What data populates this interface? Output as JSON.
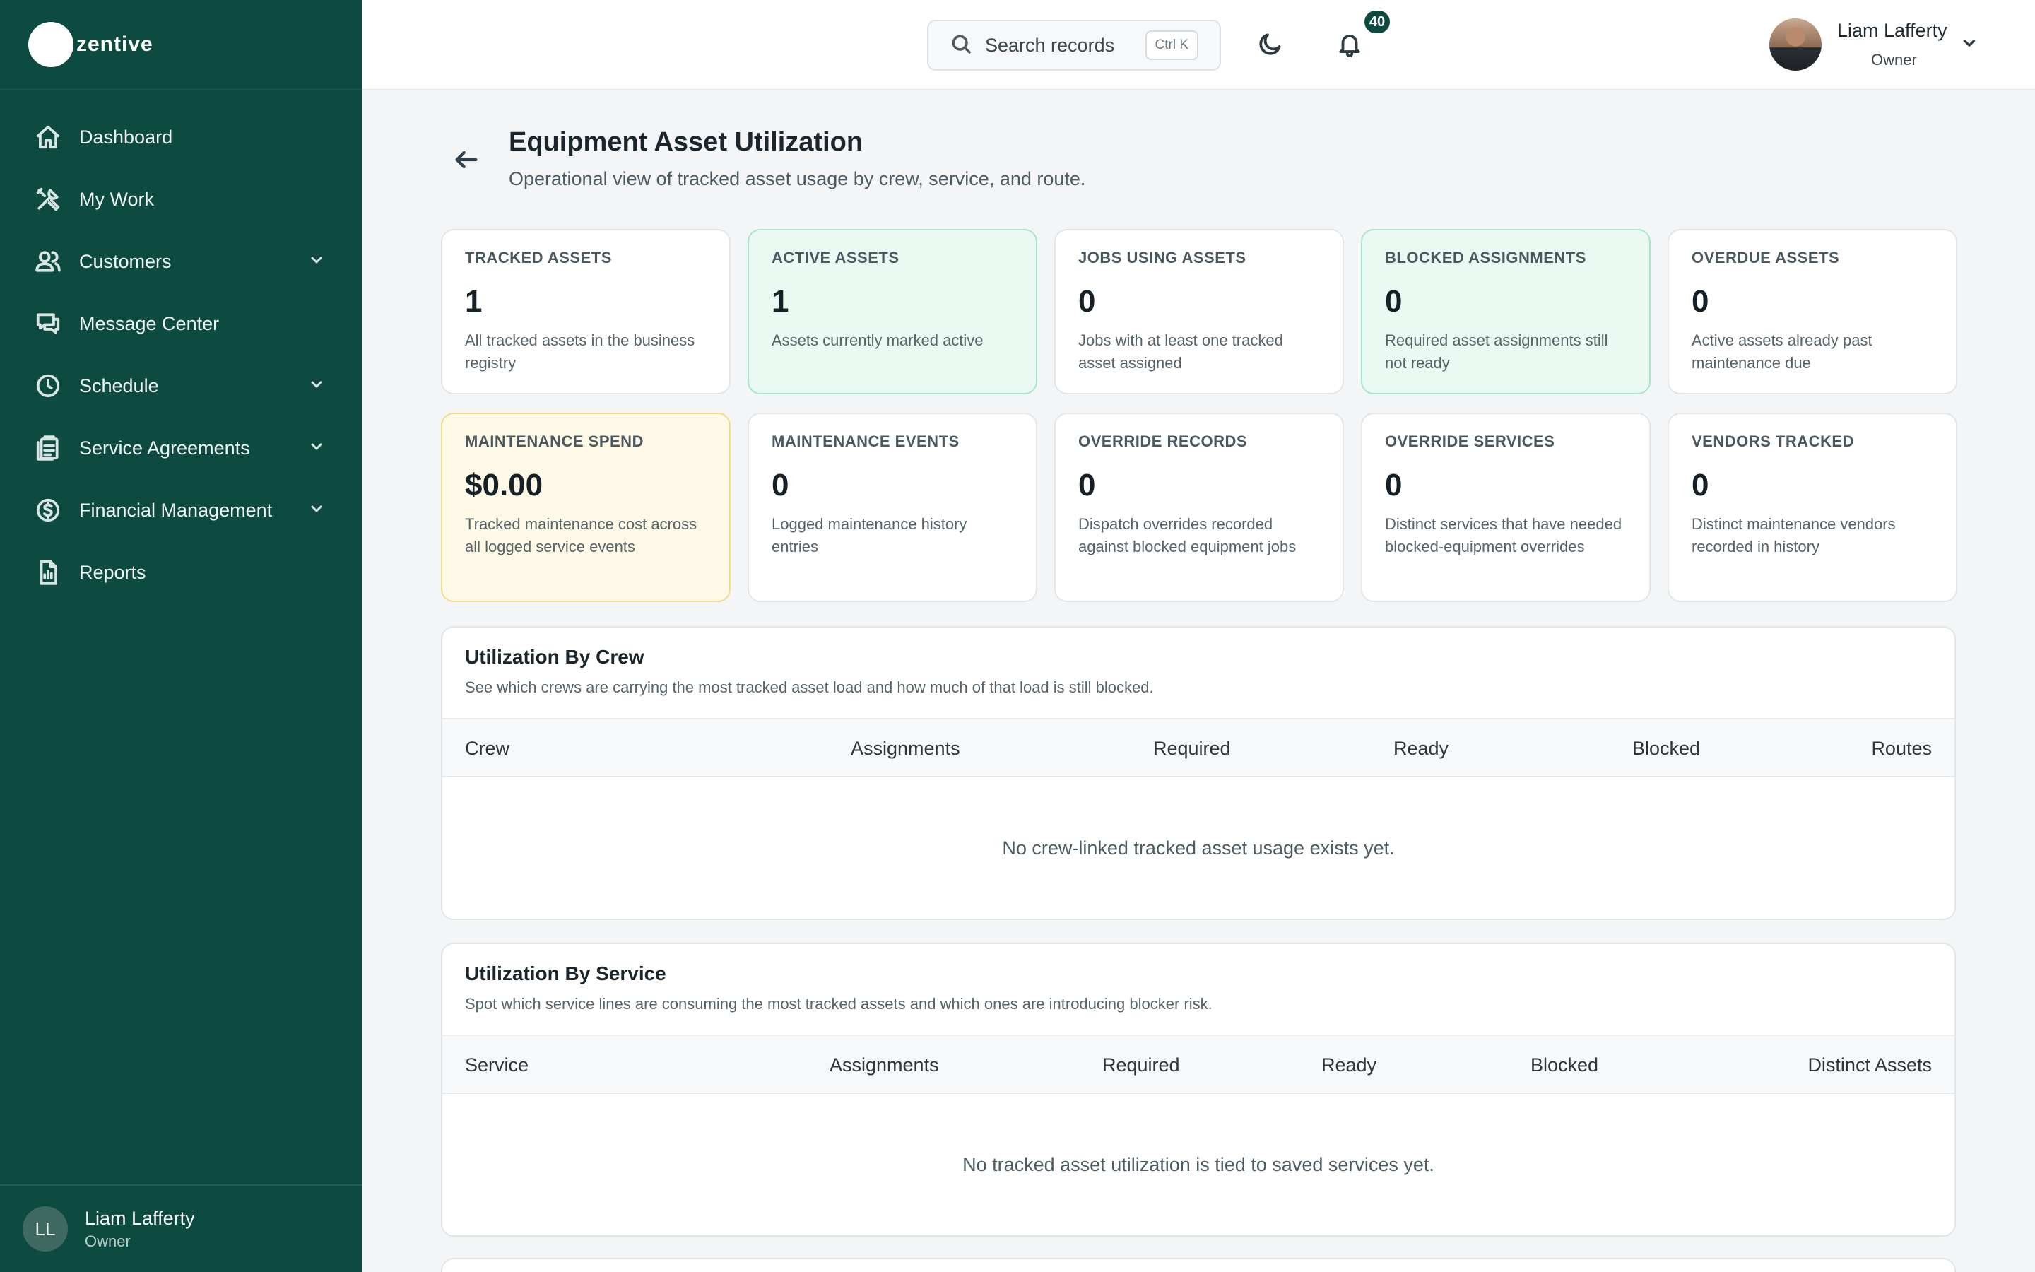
{
  "brand": {
    "name": "zentive"
  },
  "sidebar": {
    "items": [
      {
        "label": "Dashboard",
        "icon": "home-icon",
        "expandable": false
      },
      {
        "label": "My Work",
        "icon": "tools-icon",
        "expandable": false
      },
      {
        "label": "Customers",
        "icon": "users-icon",
        "expandable": true
      },
      {
        "label": "Message Center",
        "icon": "chat-icon",
        "expandable": false
      },
      {
        "label": "Schedule",
        "icon": "clock-icon",
        "expandable": true
      },
      {
        "label": "Service Agreements",
        "icon": "clipboard-icon",
        "expandable": true
      },
      {
        "label": "Financial Management",
        "icon": "dollar-circle-icon",
        "expandable": true
      },
      {
        "label": "Reports",
        "icon": "document-icon",
        "expandable": false
      }
    ],
    "user": {
      "initials": "LL",
      "name": "Liam Lafferty",
      "role": "Owner"
    }
  },
  "topbar": {
    "search_label": "Search records",
    "search_shortcut": "Ctrl K",
    "notification_count": "40",
    "user_name": "Liam Lafferty",
    "user_role": "Owner"
  },
  "page": {
    "title": "Equipment Asset Utilization",
    "subtitle": "Operational view of tracked asset usage by crew, service, and route."
  },
  "stats": [
    {
      "label": "TRACKED ASSETS",
      "value": "1",
      "desc": "All tracked assets in the business registry",
      "tone": "default"
    },
    {
      "label": "ACTIVE ASSETS",
      "value": "1",
      "desc": "Assets currently marked active",
      "tone": "green"
    },
    {
      "label": "JOBS USING ASSETS",
      "value": "0",
      "desc": "Jobs with at least one tracked asset assigned",
      "tone": "default"
    },
    {
      "label": "BLOCKED ASSIGNMENTS",
      "value": "0",
      "desc": "Required asset assignments still not ready",
      "tone": "green"
    },
    {
      "label": "OVERDUE ASSETS",
      "value": "0",
      "desc": "Active assets already past maintenance due",
      "tone": "default"
    },
    {
      "label": "MAINTENANCE SPEND",
      "value": "$0.00",
      "desc": "Tracked maintenance cost across all logged service events",
      "tone": "yellow"
    },
    {
      "label": "MAINTENANCE EVENTS",
      "value": "0",
      "desc": "Logged maintenance history entries",
      "tone": "default"
    },
    {
      "label": "OVERRIDE RECORDS",
      "value": "0",
      "desc": "Dispatch overrides recorded against blocked equipment jobs",
      "tone": "default"
    },
    {
      "label": "OVERRIDE SERVICES",
      "value": "0",
      "desc": "Distinct services that have needed blocked-equipment overrides",
      "tone": "default"
    },
    {
      "label": "VENDORS TRACKED",
      "value": "0",
      "desc": "Distinct maintenance vendors recorded in history",
      "tone": "default"
    }
  ],
  "sections": {
    "crew": {
      "title": "Utilization By Crew",
      "subtitle": "See which crews are carrying the most tracked asset load and how much of that load is still blocked.",
      "columns": [
        "Crew",
        "Assignments",
        "Required",
        "Ready",
        "Blocked",
        "Routes"
      ],
      "empty": "No crew-linked tracked asset usage exists yet."
    },
    "service": {
      "title": "Utilization By Service",
      "subtitle": "Spot which service lines are consuming the most tracked assets and which ones are introducing blocker risk.",
      "columns": [
        "Service",
        "Assignments",
        "Required",
        "Ready",
        "Blocked",
        "Distinct Assets"
      ],
      "empty": "No tracked asset utilization is tied to saved services yet."
    }
  }
}
